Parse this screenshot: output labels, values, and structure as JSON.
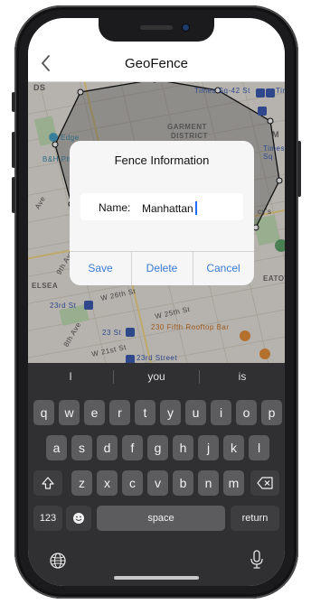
{
  "nav": {
    "title": "GeoFence",
    "back_icon": "chevron-left-icon"
  },
  "map_labels": {
    "ds": "DS",
    "times_sq_42": "Times Sq-42 St",
    "tim": "Tim",
    "edge": "Edge",
    "garment": "GARMENT",
    "district": "DISTRICT",
    "m": "M",
    "times_sq": "Times Sq",
    "bh_photo": "B&H Photo Video",
    "cy_s": "cy's",
    "ninth_ave": "9th Ave",
    "ave": "Ave",
    "eatow": "EATOW",
    "elsea": "ELSEA",
    "w26": "W 26th St",
    "w25": "W 25th St",
    "st_23": "23rd St",
    "eighth_ave": "8th Ave",
    "st23b": "23 St",
    "fifth_rooftop": "230 Fifth Rooftop Bar",
    "w21": "W 21st St",
    "st_23_street": "23rd Street"
  },
  "dialog": {
    "title": "Fence Information",
    "name_label": "Name:",
    "name_value": "Manhattan",
    "buttons": {
      "save": "Save",
      "delete": "Delete",
      "cancel": "Cancel"
    },
    "accent_color": "#3a7bd5"
  },
  "keyboard": {
    "suggestions": [
      "I",
      "you",
      "is"
    ],
    "row1": [
      "q",
      "w",
      "e",
      "r",
      "t",
      "y",
      "u",
      "i",
      "o",
      "p"
    ],
    "row2": [
      "a",
      "s",
      "d",
      "f",
      "g",
      "h",
      "j",
      "k",
      "l"
    ],
    "row3": [
      "z",
      "x",
      "c",
      "v",
      "b",
      "n",
      "m"
    ],
    "shift_icon": "shift-icon",
    "backspace_icon": "backspace-icon",
    "numbers_label": "123",
    "emoji_icon": "emoji-icon",
    "space_label": "space",
    "return_label": "return",
    "globe_icon": "globe-icon",
    "mic_icon": "microphone-icon"
  }
}
